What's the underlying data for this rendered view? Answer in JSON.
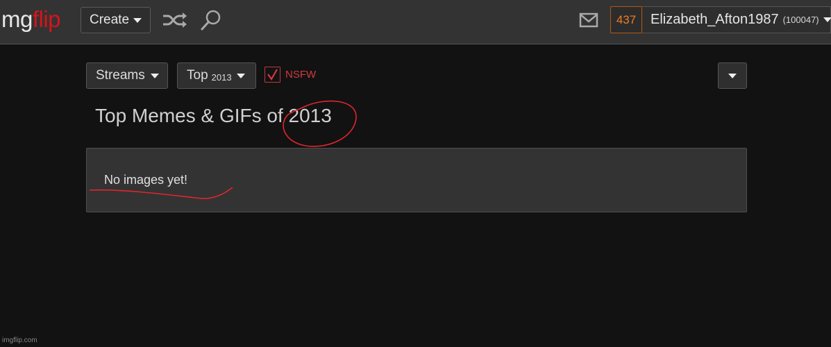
{
  "header": {
    "logo_part1": "mg",
    "logo_part2": "flip",
    "create_label": "Create",
    "points": "437",
    "username": "Elizabeth_Afton1987",
    "user_id": "(100047)"
  },
  "filters": {
    "streams_label": "Streams",
    "top_label": "Top",
    "top_year": "2013",
    "nsfw_label": "NSFW",
    "nsfw_checked": true
  },
  "main": {
    "title": "Top Memes & GIFs of 2013",
    "empty_message": "No images yet!"
  },
  "colors": {
    "brand_red": "#d8131b",
    "points_orange": "#f07d22",
    "annotation_red": "#e0262c"
  },
  "watermark": "imgflip.com"
}
